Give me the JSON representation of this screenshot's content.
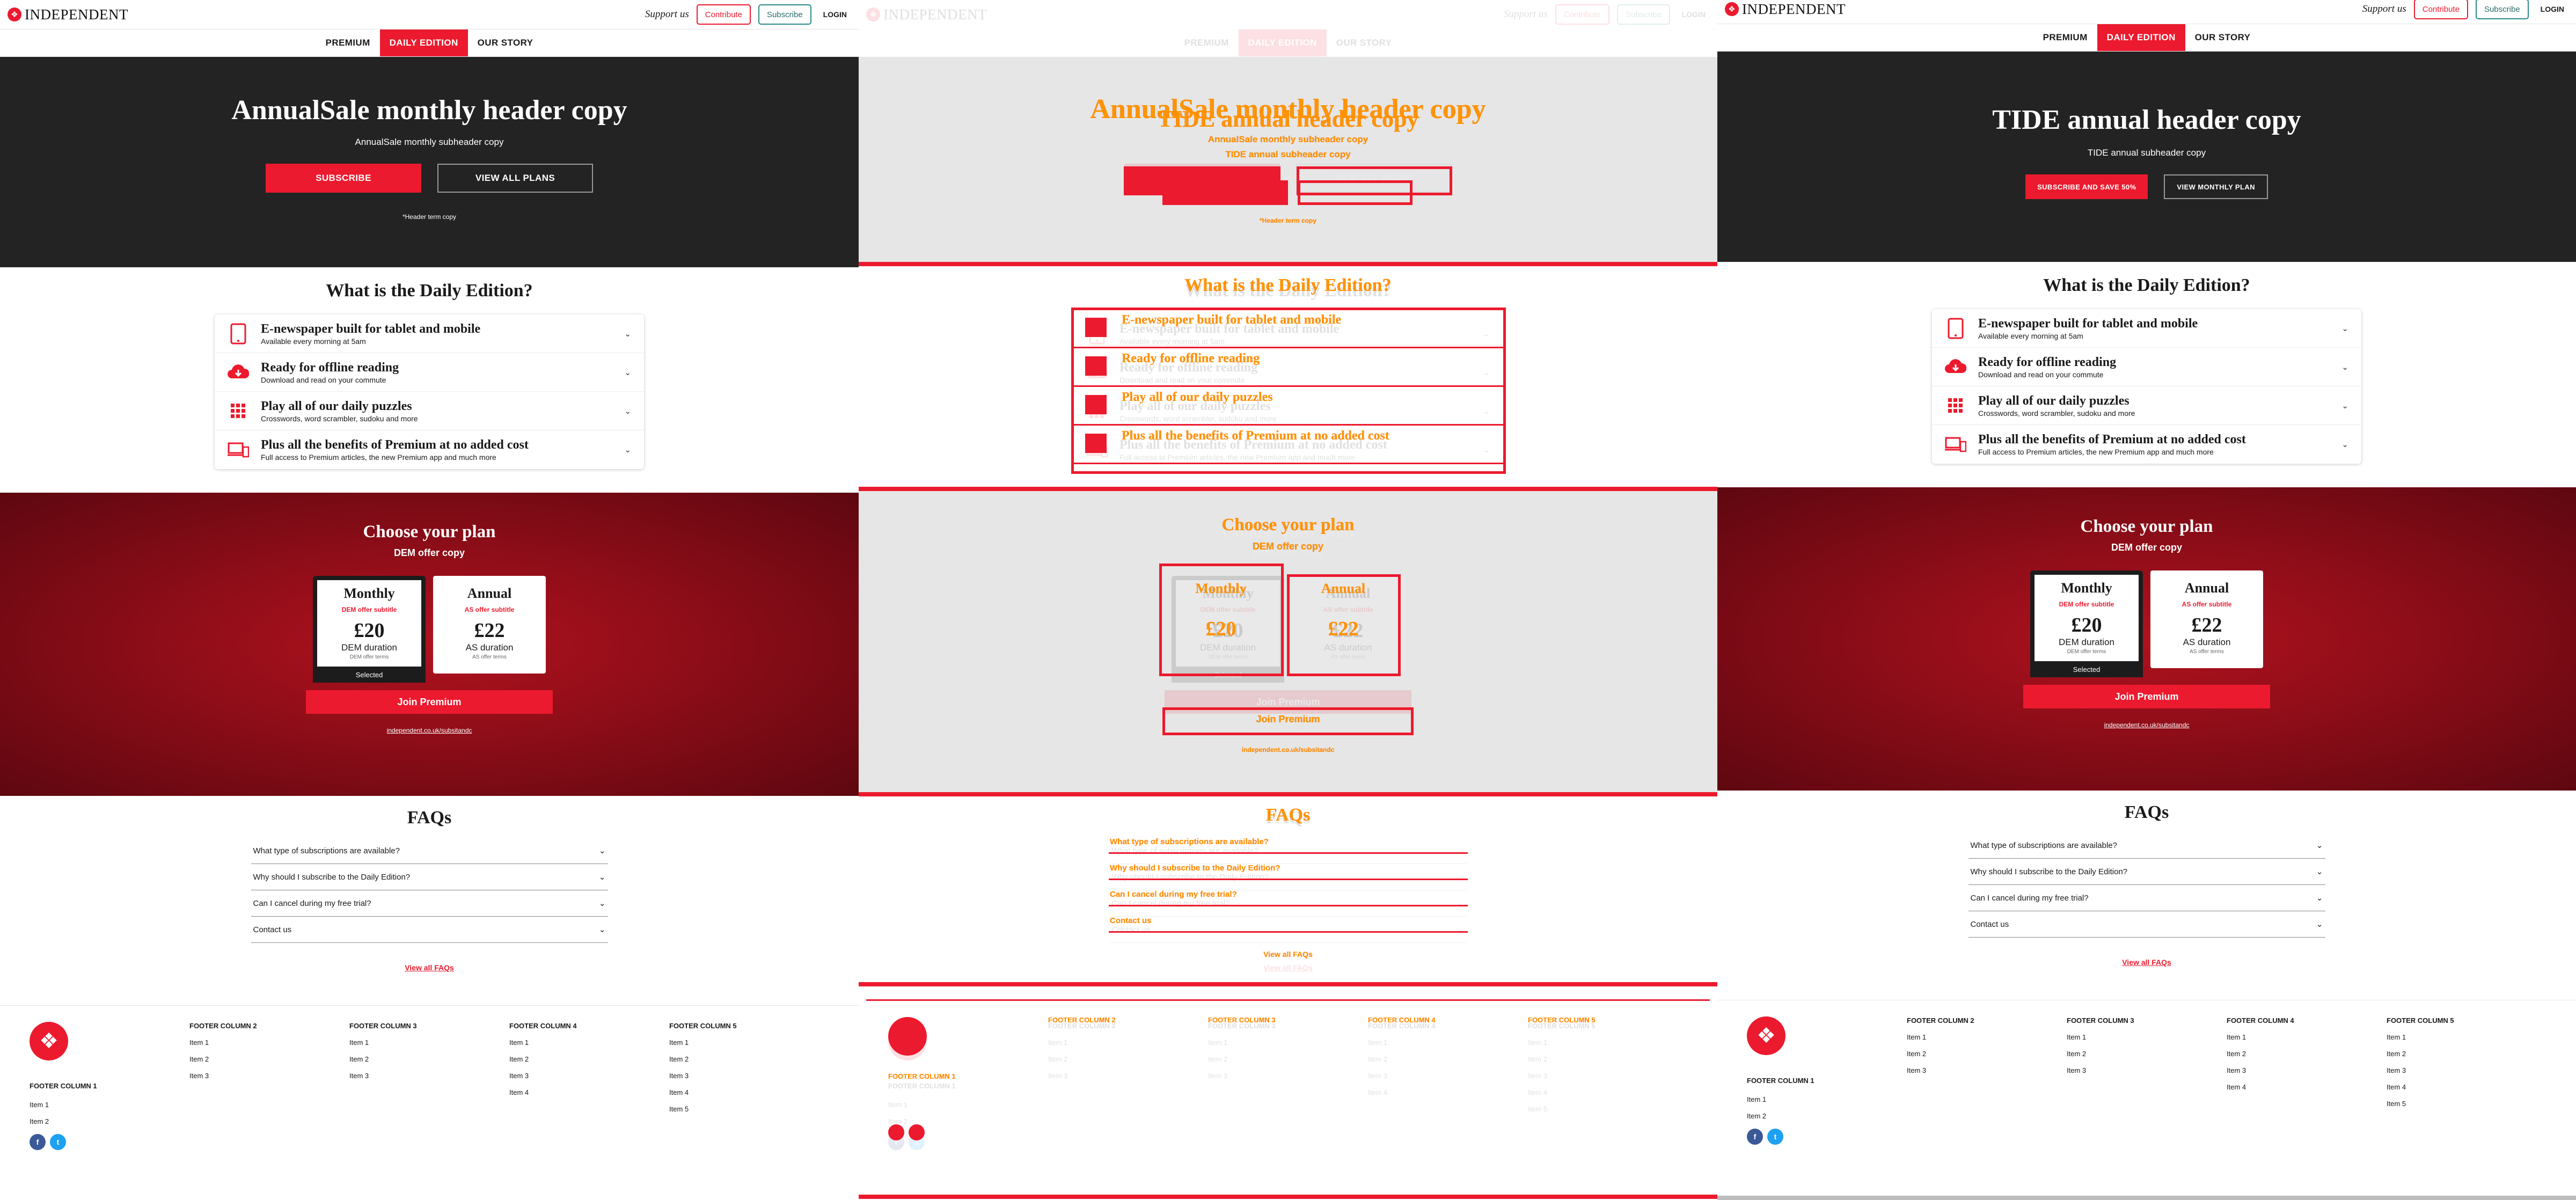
{
  "topbar": {
    "logo_text": "INDEPENDENT",
    "support_text": "Support us",
    "contribute_label": "Contribute",
    "subscribe_label": "Subscribe",
    "login_label": "LOGIN"
  },
  "nav_tabs": [
    "PREMIUM",
    "DAILY EDITION",
    "OUR STORY"
  ],
  "hero_left": {
    "title": "AnnualSale monthly header copy",
    "subtitle": "AnnualSale monthly subheader copy",
    "primary_button": "SUBSCRIBE",
    "secondary_button": "VIEW ALL PLANS",
    "term": "*Header term copy"
  },
  "hero_right": {
    "title": "TIDE annual header copy",
    "subtitle": "TIDE annual subheader copy",
    "primary_button": "SUBSCRIBE AND SAVE 50%",
    "secondary_button": "VIEW MONTHLY PLAN"
  },
  "features": {
    "heading": "What is the Daily Edition?",
    "items": [
      {
        "title": "E-newspaper built for tablet and mobile",
        "subtitle": "Available every morning at 5am",
        "icon": "tablet-icon"
      },
      {
        "title": "Ready for offline reading",
        "subtitle": "Download and read on your commute",
        "icon": "cloud-download-icon"
      },
      {
        "title": "Play all of our daily puzzles",
        "subtitle": "Crosswords, word scrambler, sudoku and more",
        "icon": "grid-icon"
      },
      {
        "title": "Plus all the benefits of Premium at no added cost",
        "subtitle": "Full access to Premium articles, the new Premium app and much more",
        "icon": "devices-icon"
      }
    ]
  },
  "plans": {
    "heading": "Choose your plan",
    "offer": "DEM offer copy",
    "cards": [
      {
        "name": "Monthly",
        "offer": "DEM offer subtitle",
        "price": "£20",
        "duration": "DEM duration",
        "terms": "DEM offer terms"
      },
      {
        "name": "Annual",
        "offer": "AS offer subtitle",
        "price": "£22",
        "duration": "AS duration",
        "terms": "AS offer terms"
      }
    ],
    "selected_label": "Selected",
    "join_label": "Join Premium",
    "link": "independent.co.uk/subsitandc"
  },
  "faq": {
    "heading": "FAQs",
    "questions": [
      "What type of subscriptions are available?",
      "Why should I subscribe to the Daily Edition?",
      "Can I cancel during my free trial?",
      "Contact us"
    ],
    "view_all": "View all FAQs"
  },
  "footer": {
    "columns": [
      {
        "title": "FOOTER COLUMN 1",
        "items": [
          "Item 1",
          "Item 2"
        ]
      },
      {
        "title": "FOOTER COLUMN 2",
        "items": [
          "Item 1",
          "Item 2",
          "Item 3"
        ]
      },
      {
        "title": "FOOTER COLUMN 3",
        "items": [
          "Item 1",
          "Item 2",
          "Item 3"
        ]
      },
      {
        "title": "FOOTER COLUMN 4",
        "items": [
          "Item 1",
          "Item 2",
          "Item 3",
          "Item 4"
        ]
      },
      {
        "title": "FOOTER COLUMN 5",
        "items": [
          "Item 1",
          "Item 2",
          "Item 3",
          "Item 4",
          "Item 5"
        ]
      }
    ],
    "social": [
      "facebook-icon",
      "twitter-icon"
    ]
  },
  "colors": {
    "brand_red": "#ec1a2e",
    "dark": "#232323",
    "plan_red": "#8d0d18",
    "diff_orange": "#ff9400"
  }
}
